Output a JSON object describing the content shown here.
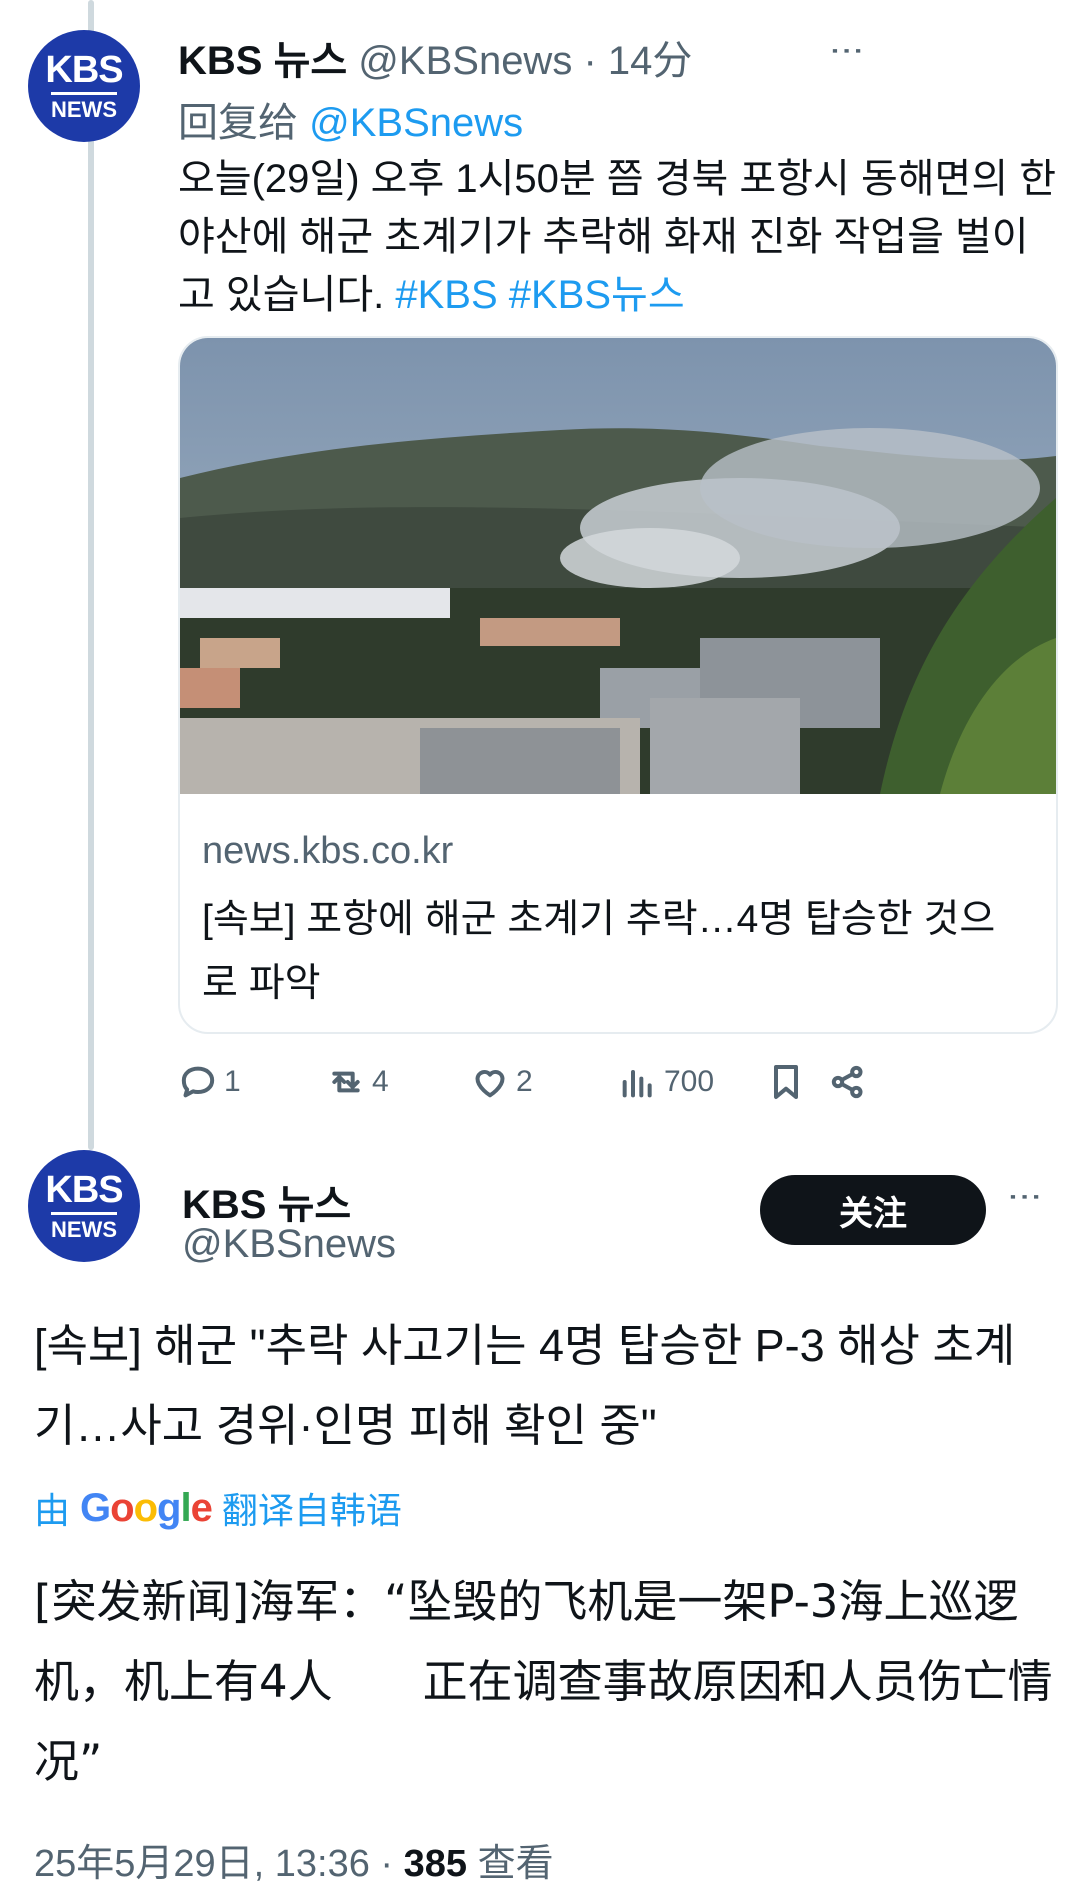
{
  "tweet1": {
    "avatar": {
      "line1": "KBS",
      "line2": "NEWS"
    },
    "display_name": "KBS 뉴스",
    "handle": "@KBSnews",
    "separator": " · ",
    "time": "14分",
    "reply_prefix": "回复给 ",
    "reply_handle": "@KBSnews",
    "text": "오늘(29일) 오후 1시50분 쯤 경북 포항시 동해면의 한 야산에 해군 초계기가 추락해 화재 진화 작업을 벌이고 있습니다. ",
    "hashtags": "#KBS #KBS뉴스",
    "card": {
      "domain": "news.kbs.co.kr",
      "title": "[속보] 포항에 해군 초계기 추락…4명 탑승한 것으로 파악"
    },
    "actions": {
      "replies": "1",
      "retweets": "4",
      "likes": "2",
      "views": "700"
    }
  },
  "tweet2": {
    "avatar": {
      "line1": "KBS",
      "line2": "NEWS"
    },
    "display_name": "KBS 뉴스",
    "handle": "@KBSnews",
    "follow_label": "关注",
    "text": "[속보] 해군 \"추락 사고기는 4명 탑승한 P-3 해상 초계기…사고 경위·인명 피해 확인 중\"",
    "translate_prefix": "由",
    "translate_brand": "Google",
    "translate_suffix": "翻译自韩语",
    "translated_text": "[突发新闻]海军：“坠毁的飞机是一架P-3海上巡逻机，机上有4人　　正在调查事故原因和人员伤亡情况”",
    "meta_date": "25年5月29日, 13:36 · ",
    "meta_views": "385",
    "meta_views_label": " 查看"
  },
  "colors": {
    "link": "#1d9bf0",
    "muted": "#536471",
    "avatar_bg": "#1d3aa8",
    "follow_bg": "#0f1419"
  },
  "icons": [
    "reply-icon",
    "retweet-icon",
    "like-icon",
    "views-icon",
    "bookmark-icon",
    "share-icon",
    "more-icon"
  ]
}
